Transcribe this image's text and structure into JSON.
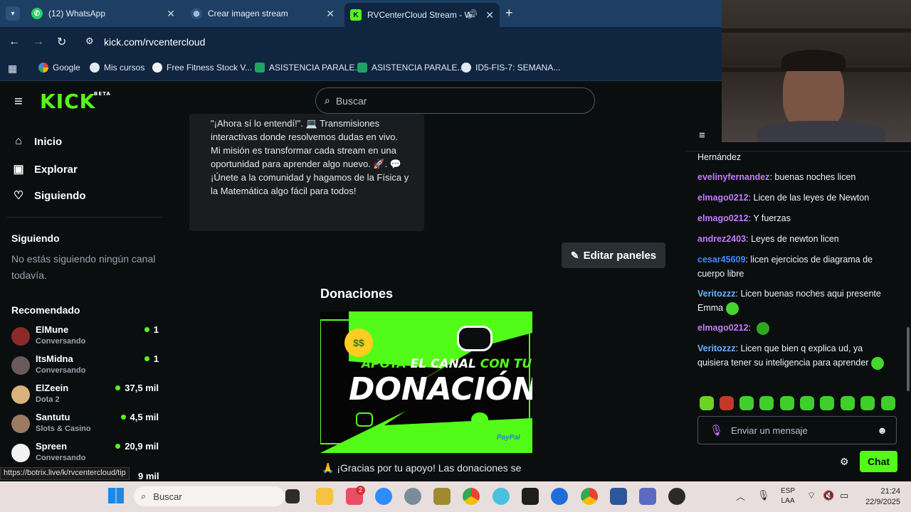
{
  "browser": {
    "tabs": [
      {
        "title": "(12) WhatsApp"
      },
      {
        "title": "Crear imagen stream"
      },
      {
        "title": "RVCenterCloud Stream - W"
      }
    ],
    "url": "kick.com/rvcentercloud",
    "bookmarks": [
      "Google",
      "Mis cursos",
      "Free Fitness Stock V...",
      "ASISTENCIA PARALE...",
      "ASISTENCIA PARALE...",
      "ID5-FIS-7: SEMANA..."
    ],
    "status_url": "https://botrix.live/k/rvcentercloud/tip"
  },
  "kick": {
    "logo": "KICK",
    "logo_badge": "BETA",
    "search_placeholder": "Buscar",
    "nav": [
      {
        "label": "Inicio",
        "icon": "home-icon"
      },
      {
        "label": "Explorar",
        "icon": "browse-icon"
      },
      {
        "label": "Siguiendo",
        "icon": "heart-icon"
      }
    ],
    "following_title": "Siguiendo",
    "following_empty": "No estás siguiendo ningún canal todavía.",
    "recommended_title": "Recomendado",
    "recommended": [
      {
        "name": "ElMune",
        "category": "Conversando",
        "viewers": "1"
      },
      {
        "name": "ItsMidna",
        "category": "Conversando",
        "viewers": "1"
      },
      {
        "name": "ElZeein",
        "category": "Dota 2",
        "viewers": "37,5 mil"
      },
      {
        "name": "Santutu",
        "category": "Slots & Casino",
        "viewers": "4,5 mil"
      },
      {
        "name": "Spreen",
        "category": "Conversando",
        "viewers": "20,9 mil"
      }
    ],
    "partial_viewers": "9 mil"
  },
  "about_panel": {
    "text": "\"¡Ahora sí lo entendí!\". 💻 Transmisiones interactivas donde resolvemos dudas en vivo. Mi misión es transformar cada stream en una oportunidad para aprender algo nuevo. 🚀. 💬 ¡Únete a la comunidad y ha­gamos de la Física y la Matemática algo fá­cil para todos!"
  },
  "edit_panels_label": "Editar paneles",
  "donations": {
    "title": "Donaciones",
    "banner_line1_a": "APOYA",
    "banner_line1_b": "EL CANAL",
    "banner_line1_c": "CON TU",
    "banner_line2": "DONACIÓN",
    "banner_paypal": "PayPal",
    "footer_text": "🙏 ¡Gracias por tu apoyo! Las donaciones se"
  },
  "chat": {
    "messages": [
      {
        "user": "",
        "text": "Hernández",
        "color": "#f0f2f4"
      },
      {
        "user": "evelinyfernandez",
        "text": "buenas noches licen",
        "color": "#c47bff"
      },
      {
        "user": "elmago0212",
        "text": "Licen de las leyes de Newton",
        "color": "#c47bff"
      },
      {
        "user": "elmago0212",
        "text": "Y fuerzas",
        "color": "#c47bff"
      },
      {
        "user": "andrez2403",
        "text": "Leyes de newton licen",
        "color": "#c47bff"
      },
      {
        "user": "cesar45609",
        "text": "licen ejercicios de diagrama de cuerpo libre",
        "color": "#3d8bff"
      },
      {
        "user": "Veritozzz",
        "text": "Licen buenas noches aqui presente Emma",
        "color": "#6ab2ff"
      },
      {
        "user": "elmago0212",
        "text": "",
        "color": "#c47bff"
      },
      {
        "user": "Veritozzz",
        "text": "Licen que bien q explica ud, ya quisiera tener su inteligencia para aprender",
        "color": "#6ab2ff"
      }
    ],
    "input_placeholder": "Enviar un mensaje",
    "send_label": "Chat"
  },
  "taskbar": {
    "search_placeholder": "Buscar",
    "lang": "ESP",
    "lang2": "LAA",
    "time": "21:24",
    "date": "22/9/2025",
    "telegram_badge": "2"
  },
  "colors": {
    "kick_green": "#53fc18",
    "tab_bar": "#1d3f63",
    "page_bg": "#0b0e0f"
  }
}
